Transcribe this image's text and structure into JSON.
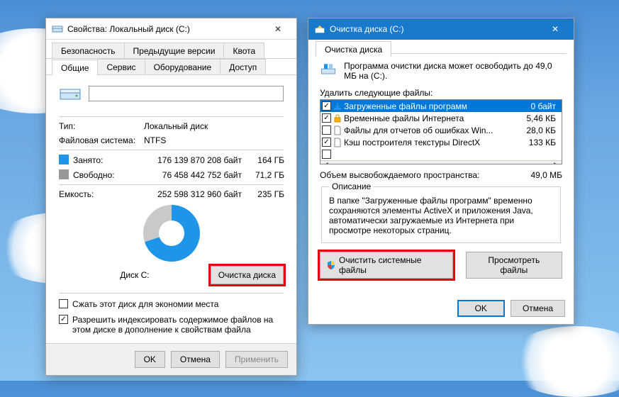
{
  "props": {
    "title": "Свойства: Локальный диск (C:)",
    "tabs_top": {
      "security": "Безопасность",
      "prev": "Предыдущие версии",
      "quota": "Квота"
    },
    "tabs_bottom": {
      "general": "Общие",
      "service": "Сервис",
      "hardware": "Оборудование",
      "access": "Доступ"
    },
    "labels": {
      "type": "Тип:",
      "fs": "Файловая система:",
      "used": "Занято:",
      "free": "Свободно:",
      "capacity": "Емкость:",
      "diskc": "Диск C:",
      "cleanup": "Очистка диска",
      "compress": "Сжать этот диск для экономии места",
      "index": "Разрешить индексировать содержимое файлов на этом диске в дополнение к свойствам файла"
    },
    "values": {
      "type": "Локальный диск",
      "fs": "NTFS",
      "used_bytes": "176 139 870 208 байт",
      "used_gb": "164 ГБ",
      "free_bytes": "76 458 442 752 байт",
      "free_gb": "71,2 ГБ",
      "cap_bytes": "252 598 312 960 байт",
      "cap_gb": "235 ГБ"
    },
    "buttons": {
      "ok": "OK",
      "cancel": "Отмена",
      "apply": "Применить"
    },
    "compress_checked": false,
    "index_checked": true
  },
  "clean": {
    "title": "Очистка диска  (C:)",
    "tab": "Очистка диска",
    "intro": "Программа очистки диска может освободить до 49,0 МБ на  (C:).",
    "delete_label": "Удалить следующие файлы:",
    "files": [
      {
        "checked": true,
        "icon": "download",
        "name": "Загруженные файлы программ",
        "size": "0 байт",
        "selected": true
      },
      {
        "checked": true,
        "icon": "lock",
        "name": "Временные файлы Интернета",
        "size": "5,46 КБ",
        "selected": false
      },
      {
        "checked": false,
        "icon": "file",
        "name": "Файлы для отчетов об ошибках Win...",
        "size": "28,0 КБ",
        "selected": false
      },
      {
        "checked": true,
        "icon": "file",
        "name": "Кэш построителя текстуры DirectX",
        "size": "133 КБ",
        "selected": false
      }
    ],
    "freed_label": "Объем высвобождаемого пространства:",
    "freed_value": "49,0 МБ",
    "desc_legend": "Описание",
    "desc_text": "В папке \"Загруженные файлы программ\" временно сохраняются элементы ActiveX и приложения Java, автоматически загружаемые из Интернета при просмотре некоторых страниц.",
    "sys_btn": "Очистить системные файлы",
    "view_btn": "Просмотреть файлы",
    "ok": "OK",
    "cancel": "Отмена"
  }
}
